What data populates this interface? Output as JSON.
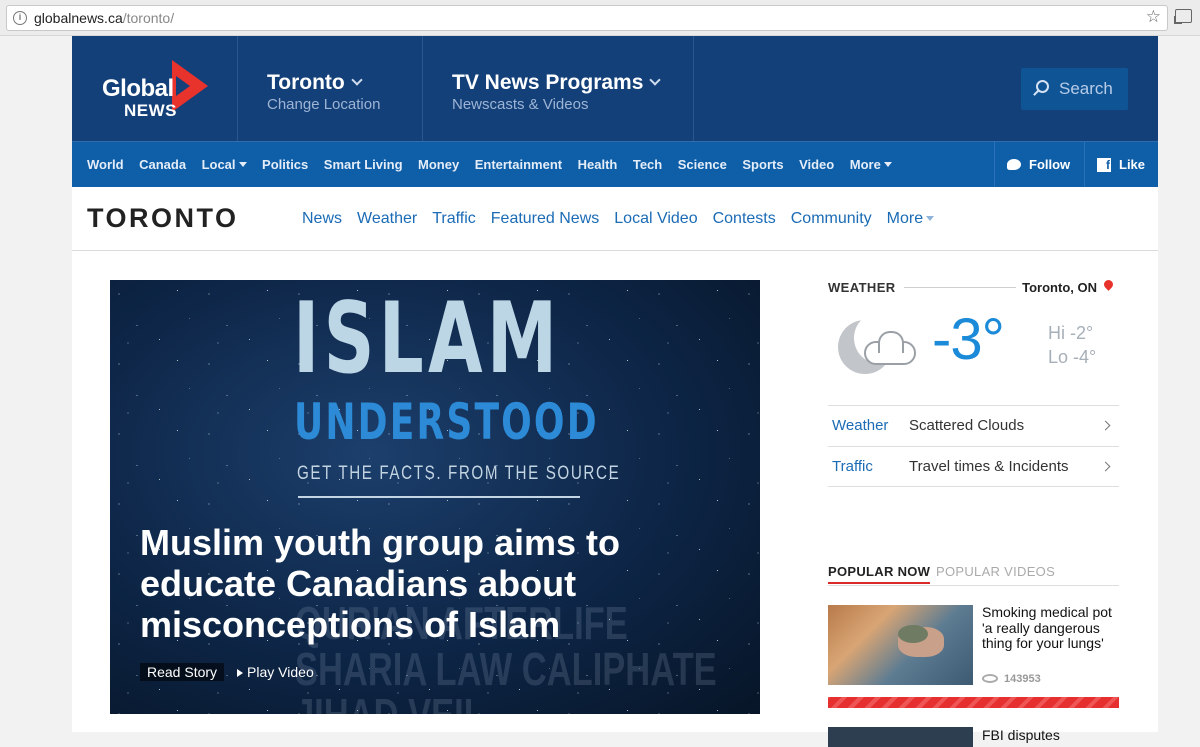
{
  "browser": {
    "url_domain": "globalnews.ca",
    "url_path": "/toronto/"
  },
  "header": {
    "logo_line1": "Global",
    "logo_line2": "NEWS",
    "location_title": "Toronto",
    "location_sub": "Change Location",
    "tv_title": "TV News Programs",
    "tv_sub": "Newscasts & Videos",
    "search_label": "Search"
  },
  "nav": {
    "items": [
      "World",
      "Canada",
      "Local",
      "Politics",
      "Smart Living",
      "Money",
      "Entertainment",
      "Health",
      "Tech",
      "Science",
      "Sports",
      "Video",
      "More"
    ],
    "follow": "Follow",
    "like": "Like"
  },
  "section": {
    "title": "TORONTO",
    "links": [
      "News",
      "Weather",
      "Traffic",
      "Featured News",
      "Local Video",
      "Contests",
      "Community",
      "More"
    ]
  },
  "hero": {
    "image_title": "ISLAM",
    "image_subtitle": "UNDERSTOOD",
    "image_tagline": "GET THE FACTS. FROM THE SOURCE",
    "bg_words_1": "QUR'AN   AFTERLIFE",
    "bg_words_2": "SHARIA LAW  CALIPHATE",
    "bg_words_3": "JIHAD  VEIL",
    "headline": "Muslim youth group aims to educate Canadians about misconceptions of Islam",
    "read_story": "Read Story",
    "play_video": "Play Video"
  },
  "weather": {
    "label": "WEATHER",
    "city": "Toronto, ON",
    "temp": "-3°",
    "hi": "Hi -2°",
    "lo": "Lo -4°",
    "rows": [
      {
        "key": "Weather",
        "value": "Scattered Clouds"
      },
      {
        "key": "Traffic",
        "value": "Travel times & Incidents"
      }
    ]
  },
  "popular": {
    "tab_active": "POPULAR NOW",
    "tab_inactive": "POPULAR VIDEOS",
    "item1_title": "Smoking medical pot 'a really dangerous thing for your lungs'",
    "item1_views": "143953",
    "item2_title": "FBI disputes"
  },
  "colors": {
    "header_bg": "#14407a",
    "nav_bg": "#0e5ea8",
    "link": "#1b6bb5",
    "accent_red": "#e8322c",
    "temp_blue": "#1b8ad8"
  }
}
